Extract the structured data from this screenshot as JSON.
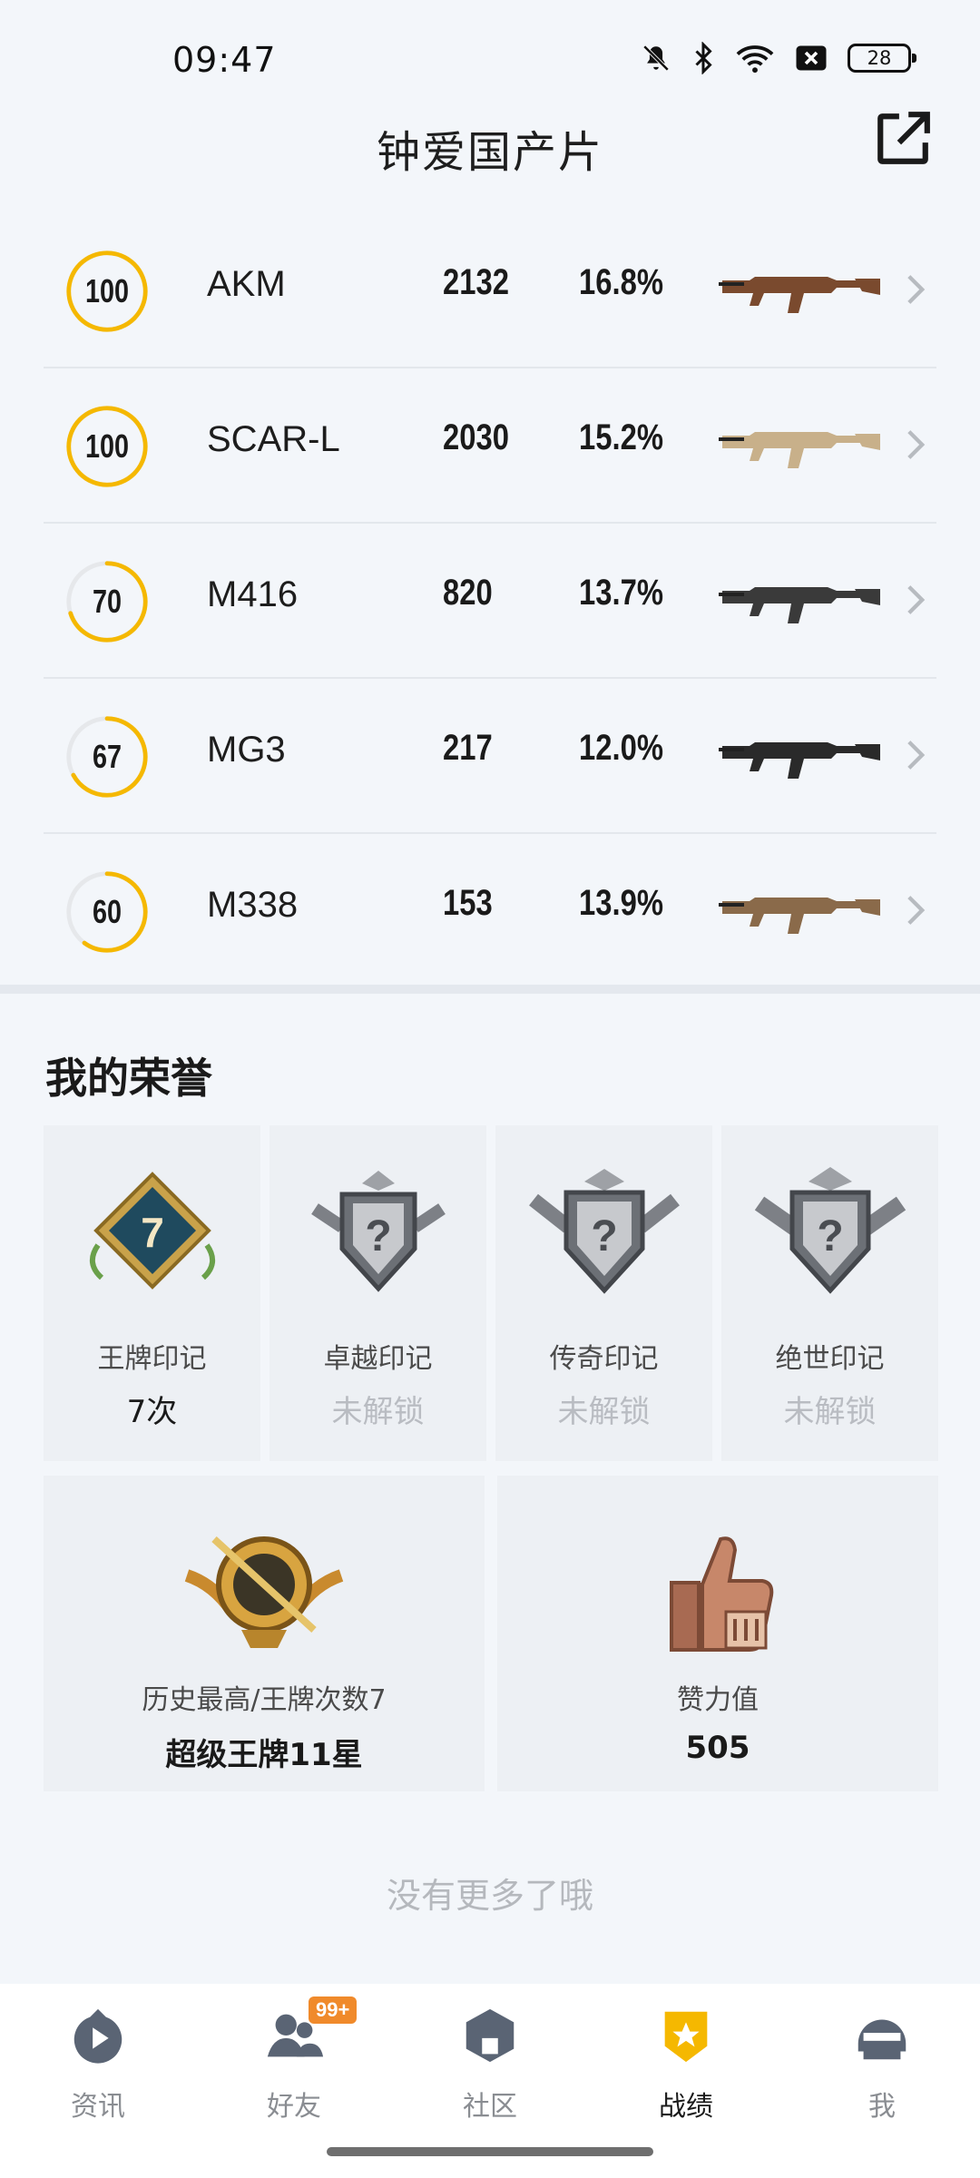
{
  "status_bar": {
    "time": "09:47",
    "battery": "28"
  },
  "header": {
    "title": "钟爱国产片"
  },
  "weapons": [
    {
      "score": "100",
      "score_fraction": 1.0,
      "name": "AKM",
      "kills": "2132",
      "pct": "16.8%",
      "gun_color": "#7a4a2e"
    },
    {
      "score": "100",
      "score_fraction": 1.0,
      "name": "SCAR-L",
      "kills": "2030",
      "pct": "15.2%",
      "gun_color": "#c8b08a"
    },
    {
      "score": "70",
      "score_fraction": 0.7,
      "name": "M416",
      "kills": "820",
      "pct": "13.7%",
      "gun_color": "#3a3a3a"
    },
    {
      "score": "67",
      "score_fraction": 0.67,
      "name": "MG3",
      "kills": "217",
      "pct": "12.0%",
      "gun_color": "#2a2a2a"
    },
    {
      "score": "60",
      "score_fraction": 0.6,
      "name": "M338",
      "kills": "153",
      "pct": "13.9%",
      "gun_color": "#8a6a4a"
    }
  ],
  "honors": {
    "title": "我的荣誉",
    "badges": [
      {
        "label": "王牌印记",
        "value": "7次",
        "badge_text": "7",
        "locked": false
      },
      {
        "label": "卓越印记",
        "value": "未解锁",
        "badge_text": "?",
        "locked": true
      },
      {
        "label": "传奇印记",
        "value": "未解锁",
        "badge_text": "?",
        "locked": true
      },
      {
        "label": "绝世印记",
        "value": "未解锁",
        "badge_text": "?",
        "locked": true
      }
    ],
    "highest": {
      "label": "历史最高/王牌次数7",
      "value": "超级王牌11星"
    },
    "likes": {
      "label": "赞力值",
      "value": "505"
    }
  },
  "footer_text": "没有更多了哦",
  "nav": {
    "items": [
      {
        "label": "资讯",
        "icon": "news-icon"
      },
      {
        "label": "好友",
        "icon": "friends-icon",
        "badge": "99+"
      },
      {
        "label": "社区",
        "icon": "community-icon"
      },
      {
        "label": "战绩",
        "icon": "record-icon",
        "active": true
      },
      {
        "label": "我",
        "icon": "profile-icon"
      }
    ]
  },
  "colors": {
    "ring_accent": "#f5b800",
    "ring_track": "#e6e8eb",
    "active_nav": "#f5b800",
    "badge_orange": "#f08a2b"
  }
}
